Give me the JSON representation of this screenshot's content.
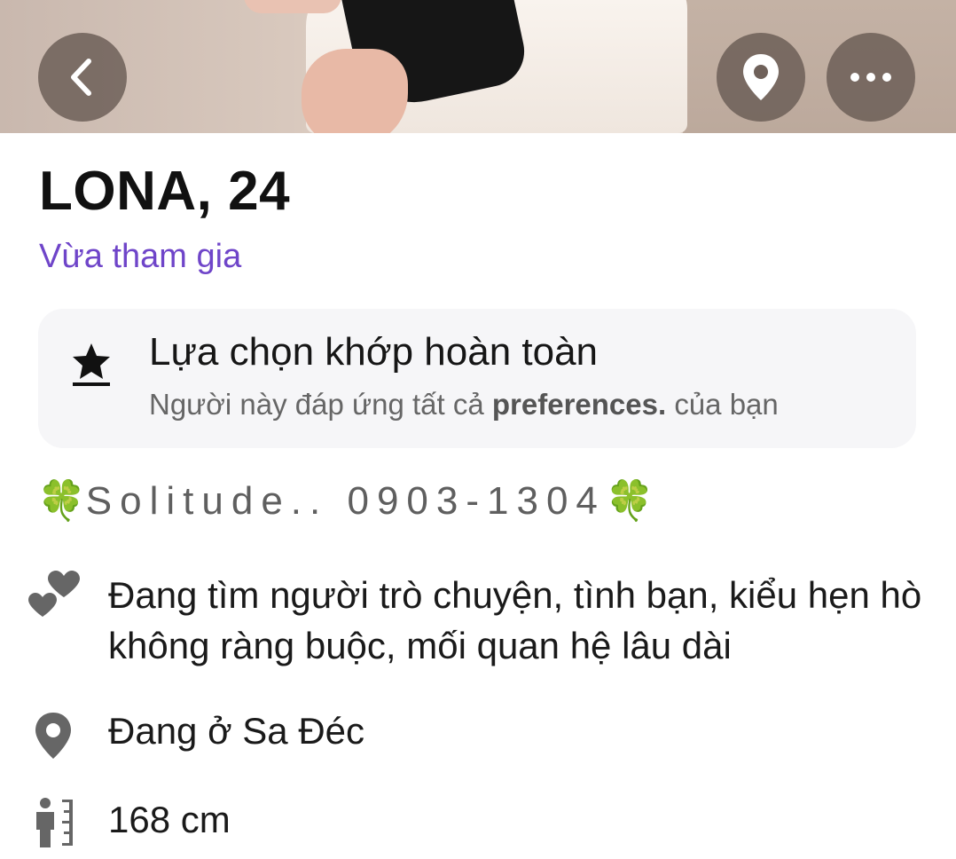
{
  "header": {
    "back_icon": "chevron-left-icon",
    "location_icon": "map-pin-icon",
    "more_icon": "ellipsis-icon"
  },
  "profile": {
    "name_age": "LONA, 24",
    "joined_status": "Vừa tham gia",
    "bio": {
      "emoji": "🍀",
      "text": "Solitude.. 0903-1304"
    }
  },
  "match_card": {
    "icon": "star-podium-icon",
    "title": "Lựa chọn khớp hoàn toàn",
    "subtitle_before": "Người này đáp ứng tất cả ",
    "subtitle_bold": "preferences.",
    "subtitle_after": " của bạn"
  },
  "details": {
    "looking_for": "Đang tìm người trò chuyện, tình bạn, kiểu hẹn hò không ràng buộc, mối quan hệ lâu dài",
    "location": "Đang ở Sa Đéc",
    "height": "168 cm"
  },
  "colors": {
    "accent_purple": "#6f45c9",
    "card_bg": "#f6f6f8",
    "icon_gray": "#666666"
  }
}
